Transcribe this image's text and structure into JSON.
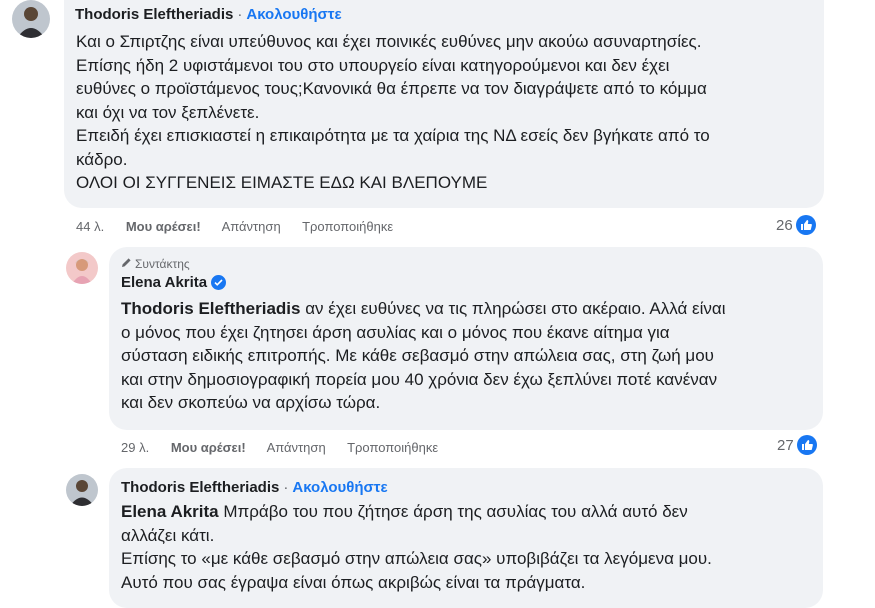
{
  "comment1": {
    "author": "Thodoris Eleftheriadis",
    "dot": "·",
    "follow": "Ακολουθήστε",
    "lines": [
      "Και ο Σπιρτζης είναι υπεύθυνος και έχει ποινικές ευθύνες μην ακούω ασυναρτησίες.",
      "Επίσης ήδη 2 υφιστάμενοι του στο υπουργείο είναι κατηγορούμενοι και δεν έχει",
      "ευθύνες ο προϊστάμενος τους;Κανονικά θα έπρεπε να τον διαγράψετε από το κόμμα",
      "και όχι να τον ξεπλένετε.",
      "Επειδή έχει επισκιαστεί η επικαιρότητα με τα χαίρια της ΝΔ εσείς δεν βγήκατε από το",
      "κάδρο.",
      "ΟΛΟΙ ΟΙ ΣΥΓΓΕΝΕΙΣ ΕΙΜΑΣΤΕ ΕΔΩ ΚΑΙ ΒΛΕΠΟΥΜΕ"
    ],
    "time": "44 λ.",
    "like": "Μου αρέσει!",
    "reply": "Απάντηση",
    "edited": "Τροποποιήθηκε",
    "reactions": "26"
  },
  "comment2": {
    "author_tag": "Συντάκτης",
    "author": "Elena Akrita",
    "mention": "Thodoris Eleftheriadis",
    "first_rest": " αν έχει ευθύνες να τις πληρώσει στο ακέραιο. Αλλά είναι",
    "lines": [
      "ο μόνος που έχει ζητησει άρση ασυλίας και ο μόνος που έκανε αίτημα για",
      "σύσταση ειδικής επιτροπής. Με κάθε σεβασμό στην απώλεια σας, στη ζωή μου",
      "και στην δημοσιογραφική πορεία μου 40 χρόνια δεν έχω ξεπλύνει ποτέ κανέναν",
      "και δεν σκοπεύω να αρχίσω τώρα."
    ],
    "time": "29 λ.",
    "like": "Μου αρέσει!",
    "reply": "Απάντηση",
    "edited": "Τροποποιήθηκε",
    "reactions": "27"
  },
  "comment3": {
    "author": "Thodoris Eleftheriadis",
    "dot": "·",
    "follow": "Ακολουθήστε",
    "mention": "Elena Akrita",
    "first_rest": " Μπράβο του που ζήτησε άρση της ασυλίας του αλλά αυτό δεν",
    "lines": [
      "αλλάζει κάτι.",
      "Επίσης το «με κάθε σεβασμό στην απώλεια σας» υποβιβάζει τα λεγόμενα μου.",
      "Αυτό που σας έγραψα είναι όπως ακριβώς είναι τα πράγματα."
    ]
  },
  "colors": {
    "link": "#1877f2",
    "bubble": "#f0f2f5",
    "meta": "#65676b"
  },
  "icons": [
    "pen-icon",
    "verified-badge-icon",
    "like-thumb-icon"
  ]
}
